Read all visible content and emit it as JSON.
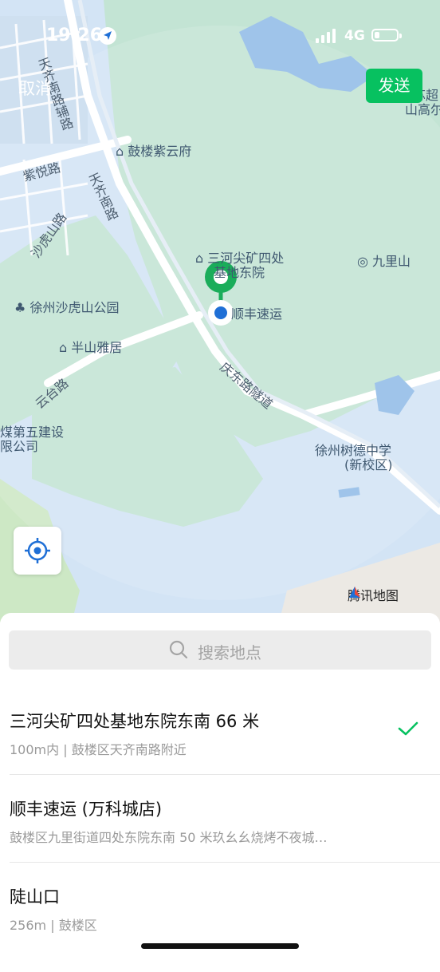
{
  "status_bar": {
    "time": "19:26",
    "network": "4G"
  },
  "nav": {
    "cancel_label": "取消",
    "send_label": "发送"
  },
  "map": {
    "labels": {
      "tianqi_nanlu_fulu": "天齐南路辅路",
      "ziyue_lu": "紫悦路",
      "tianqi_nanlu": "天齐南路",
      "shahushan_lu": "沙虎山路",
      "gulou_ziyunfu": "鼓楼紫云府",
      "sanhe_line1": "三河尖矿四处",
      "sanhe_line2": "基地东院",
      "shunfeng": "顺丰速运",
      "jiulishan": "九里山",
      "shahushan_park": "徐州沙虎山公园",
      "banshan_yaju": "半山雅居",
      "yuntai_lu": "云台路",
      "qingnian_lu": "庆东路隧道",
      "jianshe_line1": "煤第五建设",
      "jianshe_line2": "限公司",
      "shude_line1": "徐州树德中学",
      "shude_line2": "(新校区)",
      "top_right_line1": "苏超",
      "top_right_line2": "山高尔"
    },
    "brand": "腾讯地图"
  },
  "search": {
    "placeholder": "搜索地点"
  },
  "results": [
    {
      "title": "三河尖矿四处基地东院东南 66 米",
      "subtitle": "100m内 | 鼓楼区天齐南路附近",
      "selected": true
    },
    {
      "title": "顺丰速运 (万科城店)",
      "subtitle": "鼓楼区九里街道四处东院东南 50 米玖幺幺烧烤不夜城…",
      "selected": false
    },
    {
      "title": "陡山口",
      "subtitle": "256m | 鼓楼区",
      "selected": false
    }
  ],
  "colors": {
    "accent": "#07c160",
    "pin": "#1aad5a",
    "location_dot": "#1f6fd6"
  }
}
